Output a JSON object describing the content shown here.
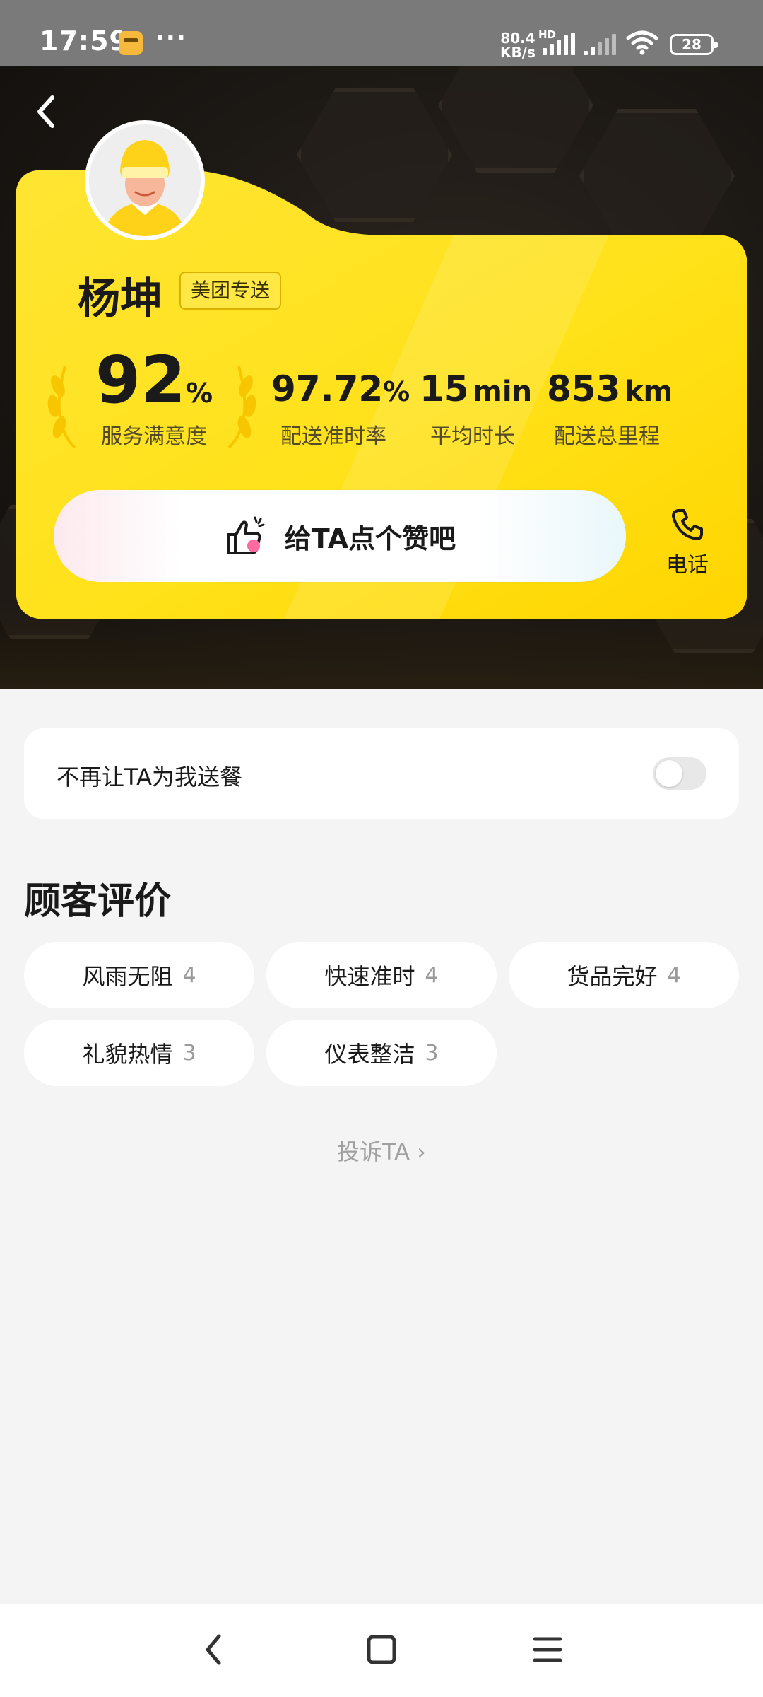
{
  "status_bar": {
    "time": "17:59",
    "app_icon": "meituan-app-icon",
    "more": "···",
    "net_speed_value": "80.4",
    "net_speed_unit": "KB/s",
    "hd": "HD",
    "battery": "28"
  },
  "rider": {
    "name": "杨坤",
    "badge": "美团专送"
  },
  "stats": [
    {
      "value": "92",
      "unit": "%",
      "label": "服务满意度"
    },
    {
      "value": "97.72",
      "unit": "%",
      "label": "配送准时率"
    },
    {
      "value": "15",
      "unit": "min",
      "label": "平均时长"
    },
    {
      "value": "853",
      "unit": "km",
      "label": "配送总里程"
    }
  ],
  "actions": {
    "like_label": "给TA点个赞吧",
    "phone_label": "电话"
  },
  "block_setting": {
    "label": "不再让TA为我送餐",
    "enabled": false
  },
  "reviews": {
    "title": "顾客评价",
    "tags": [
      {
        "label": "风雨无阻",
        "count": "4"
      },
      {
        "label": "快速准时",
        "count": "4"
      },
      {
        "label": "货品完好",
        "count": "4"
      },
      {
        "label": "礼貌热情",
        "count": "3"
      },
      {
        "label": "仪表整洁",
        "count": "3"
      }
    ]
  },
  "complain": "投诉TA ›",
  "colors": {
    "card_yellow": "#ffe21a",
    "hero_dark": "#1d1915",
    "page_bg": "#f4f4f4"
  }
}
